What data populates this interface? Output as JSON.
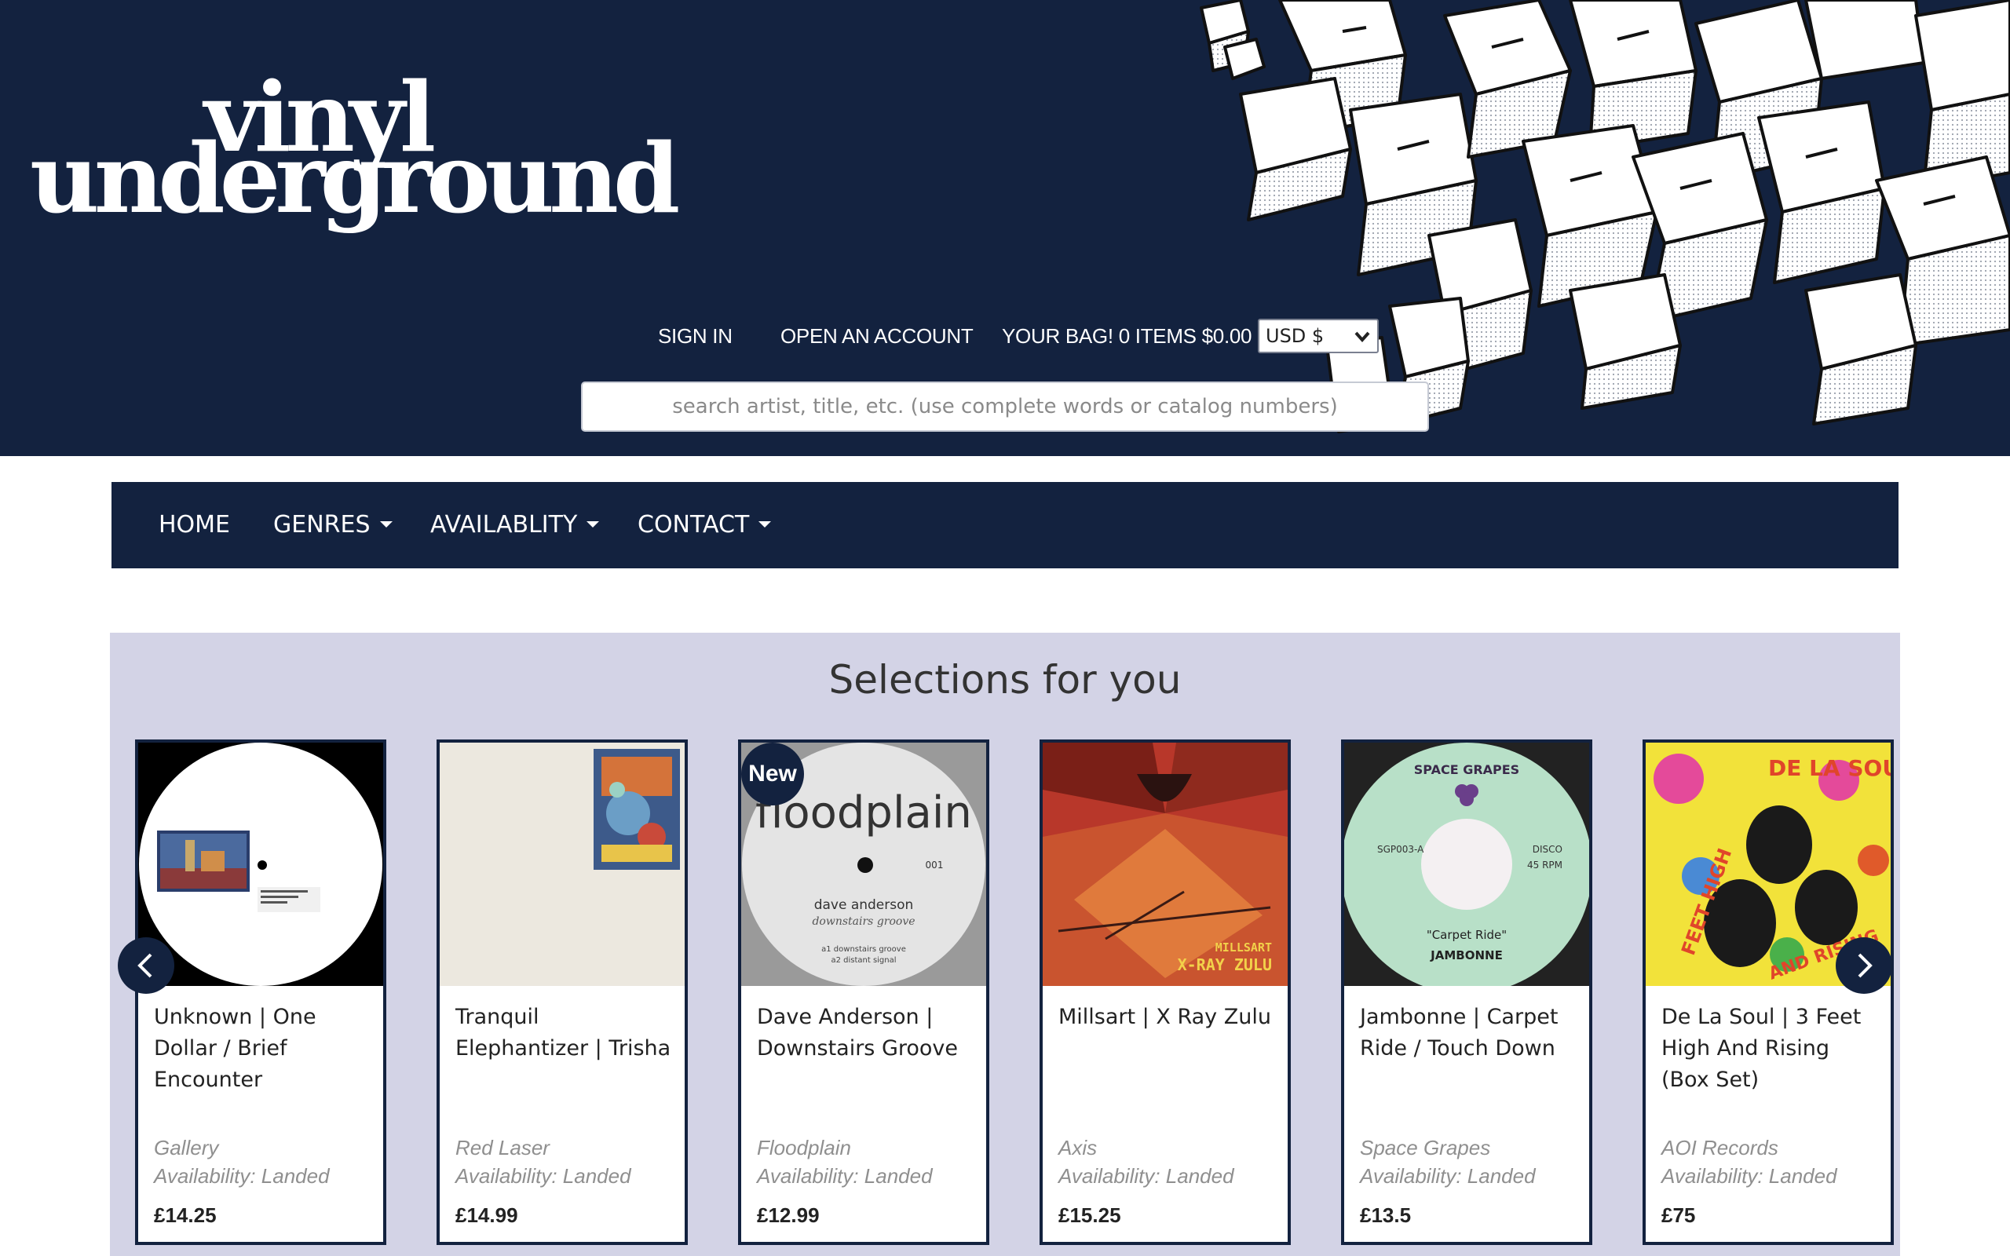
{
  "header": {
    "logo_line1": "vinyl",
    "logo_line2": "underground",
    "sign_in": "SIGN IN",
    "open_account": "OPEN AN ACCOUNT",
    "bag": "YOUR BAG! 0 ITEMS $0.00",
    "currency": "USD $",
    "search_placeholder": "search artist, title, etc.  (use complete words or catalog numbers)"
  },
  "nav": {
    "home": "HOME",
    "genres": "GENRES",
    "availability": "AVAILABLITY",
    "contact": "CONTACT"
  },
  "selections": {
    "title": "Selections for you",
    "items": [
      {
        "title": "Unknown | One Dollar / Brief Encounter",
        "label": "Gallery",
        "availability": "Availability: Landed",
        "price": "£14.25",
        "badge": ""
      },
      {
        "title": "Tranquil Elephantizer | Trisha",
        "label": "Red Laser",
        "availability": "Availability: Landed",
        "price": "£14.99",
        "badge": ""
      },
      {
        "title": "Dave Anderson | Downstairs Groove",
        "label": "Floodplain",
        "availability": "Availability: Landed",
        "price": "£12.99",
        "badge": "New"
      },
      {
        "title": "Millsart | X Ray Zulu",
        "label": "Axis",
        "availability": "Availability: Landed",
        "price": "£15.25",
        "badge": ""
      },
      {
        "title": "Jambonne | Carpet Ride / Touch Down",
        "label": "Space Grapes",
        "availability": "Availability: Landed",
        "price": "£13.5",
        "badge": ""
      },
      {
        "title": "De La Soul | 3 Feet High And Rising (Box Set)",
        "label": "AOI Records",
        "availability": "Availability: Landed",
        "price": "£75",
        "badge": ""
      }
    ]
  },
  "covers": {
    "floodplain_word": "floodplain",
    "floodplain_cat": "001",
    "floodplain_artist": "dave anderson",
    "floodplain_track": "downstairs groove",
    "floodplain_a1": "a1 downstairs groove",
    "floodplain_a2": "a2 distant signal",
    "millsart_text": "MILLSART",
    "xrayzulu_text": "X-RAY ZULU",
    "jambonne_brand": "SPACE GRAPES",
    "jambonne_cat": "SGP003-A",
    "jambonne_disco": "DISCO",
    "jambonne_rpm": "45 RPM",
    "jambonne_song": "\"Carpet Ride\"",
    "jambonne_artist": "JAMBONNE",
    "delasoul_words1": "DE LA SOUL",
    "delasoul_words2": "FEET HIGH",
    "delasoul_words3": "AND RISING"
  },
  "icons": {
    "prev": "chevron-left-icon",
    "next": "chevron-right-icon",
    "select": "chevron-down-icon"
  },
  "colors": {
    "navy": "#13223f",
    "panel": "#d3d3e6"
  }
}
